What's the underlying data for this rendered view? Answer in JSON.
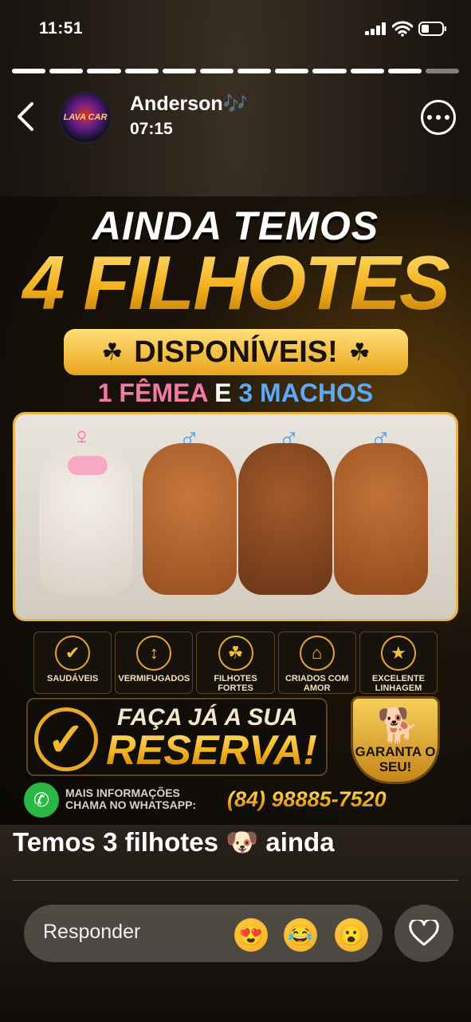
{
  "status_bar": {
    "time": "11:51"
  },
  "story": {
    "segments_total": 12,
    "segments_viewed": 11,
    "author_name": "Anderson🎶",
    "posted_time": "07:15",
    "avatar_text": "LAVA CAR"
  },
  "poster": {
    "line1": "AINDA TEMOS",
    "line2": "4 FILHOTES",
    "banner": "DISPONÍVEIS!",
    "count_female": "1 FÊMEA",
    "count_and": "E",
    "count_male": "3 MACHOS",
    "female_symbol": "♀",
    "male_symbol": "♂",
    "badges": [
      {
        "icon": "shield-check-icon",
        "glyph": "✔",
        "label": "SAUDÁVEIS"
      },
      {
        "icon": "syringe-icon",
        "glyph": "↕",
        "label": "VERMIFUGADOS"
      },
      {
        "icon": "paw-icon",
        "glyph": "☘",
        "label": "FILHOTES FORTES"
      },
      {
        "icon": "house-heart-icon",
        "glyph": "⌂",
        "label": "CRIADOS COM AMOR"
      },
      {
        "icon": "medal-icon",
        "glyph": "★",
        "label": "EXCELENTE LINHAGEM"
      }
    ],
    "reserve_line1": "FAÇA JÁ A SUA",
    "reserve_line2": "RESERVA!",
    "guarantee": "GARANTA O SEU!",
    "info_line1": "MAIS INFORMAÇÕES",
    "info_line2": "CHAMA NO WHATSAPP:",
    "phone": "(84) 98885-7520"
  },
  "caption": "Temos 3 filhotes 🐶 ainda",
  "reply": {
    "placeholder": "Responder",
    "reactions": [
      "😍",
      "😂",
      "😮"
    ]
  }
}
